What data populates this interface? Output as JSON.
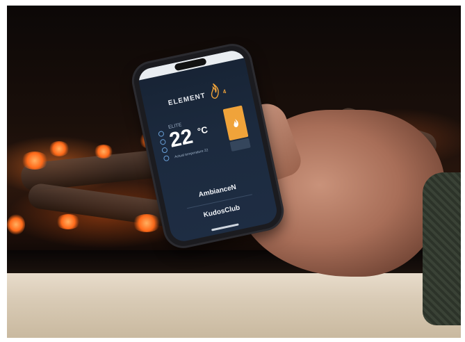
{
  "app": {
    "brand_name": "ELEMENT",
    "brand_number": "4",
    "model_label": "ELITE",
    "temperature_value": "22",
    "temperature_unit": "°C",
    "actual_temperature_label": "Actual temperature 22",
    "menu": [
      {
        "label": "AmbianceN"
      },
      {
        "label": "KudosClub"
      }
    ]
  },
  "colors": {
    "accent": "#f0a33a",
    "screen_background": "#1c2a3e",
    "hearth": "#d9cbb6"
  }
}
